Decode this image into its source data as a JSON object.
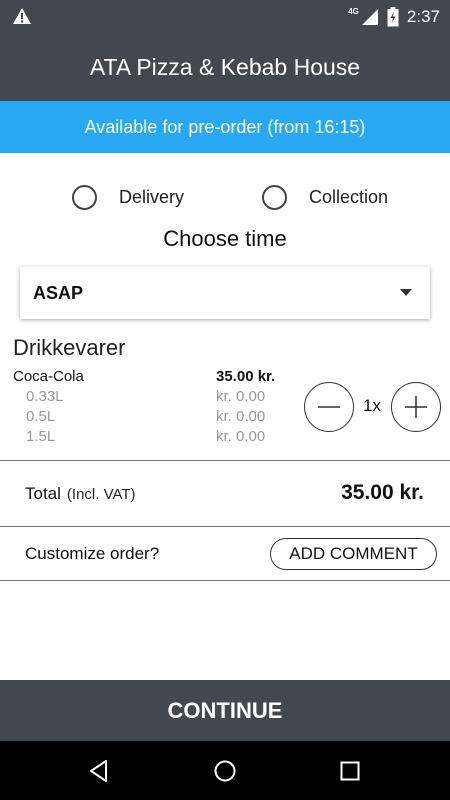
{
  "status_bar": {
    "network": "4G",
    "time": "2:37"
  },
  "app_bar": {
    "title": "ATA Pizza & Kebab House"
  },
  "banner": {
    "text": "Available for pre-order (from 16:15)"
  },
  "order_type": {
    "options": [
      {
        "label": "Delivery",
        "selected": false
      },
      {
        "label": "Collection",
        "selected": false
      }
    ]
  },
  "time_picker": {
    "heading": "Choose time",
    "selected": "ASAP"
  },
  "cart": {
    "category": "Drikkevarer",
    "item": {
      "name": "Coca-Cola",
      "price": "35.00 kr.",
      "sizes": [
        {
          "label": "0.33L",
          "price": "kr. 0.00"
        },
        {
          "label": "0.5L",
          "price": "kr. 0.00"
        },
        {
          "label": "1.5L",
          "price": "kr. 0.00"
        }
      ],
      "quantity": "1x"
    }
  },
  "total": {
    "label": "Total",
    "vat_note": "(Incl. VAT)",
    "value": "35.00 kr."
  },
  "customize": {
    "question": "Customize order?",
    "button": "ADD COMMENT"
  },
  "footer": {
    "continue": "CONTINUE"
  },
  "colors": {
    "app_bar": "#424850",
    "banner": "#29a8f3"
  },
  "icons": [
    "warning-icon",
    "signal-icon",
    "battery-icon",
    "chevron-down-icon",
    "minus-icon",
    "plus-icon",
    "back-icon",
    "home-icon",
    "recents-icon"
  ]
}
